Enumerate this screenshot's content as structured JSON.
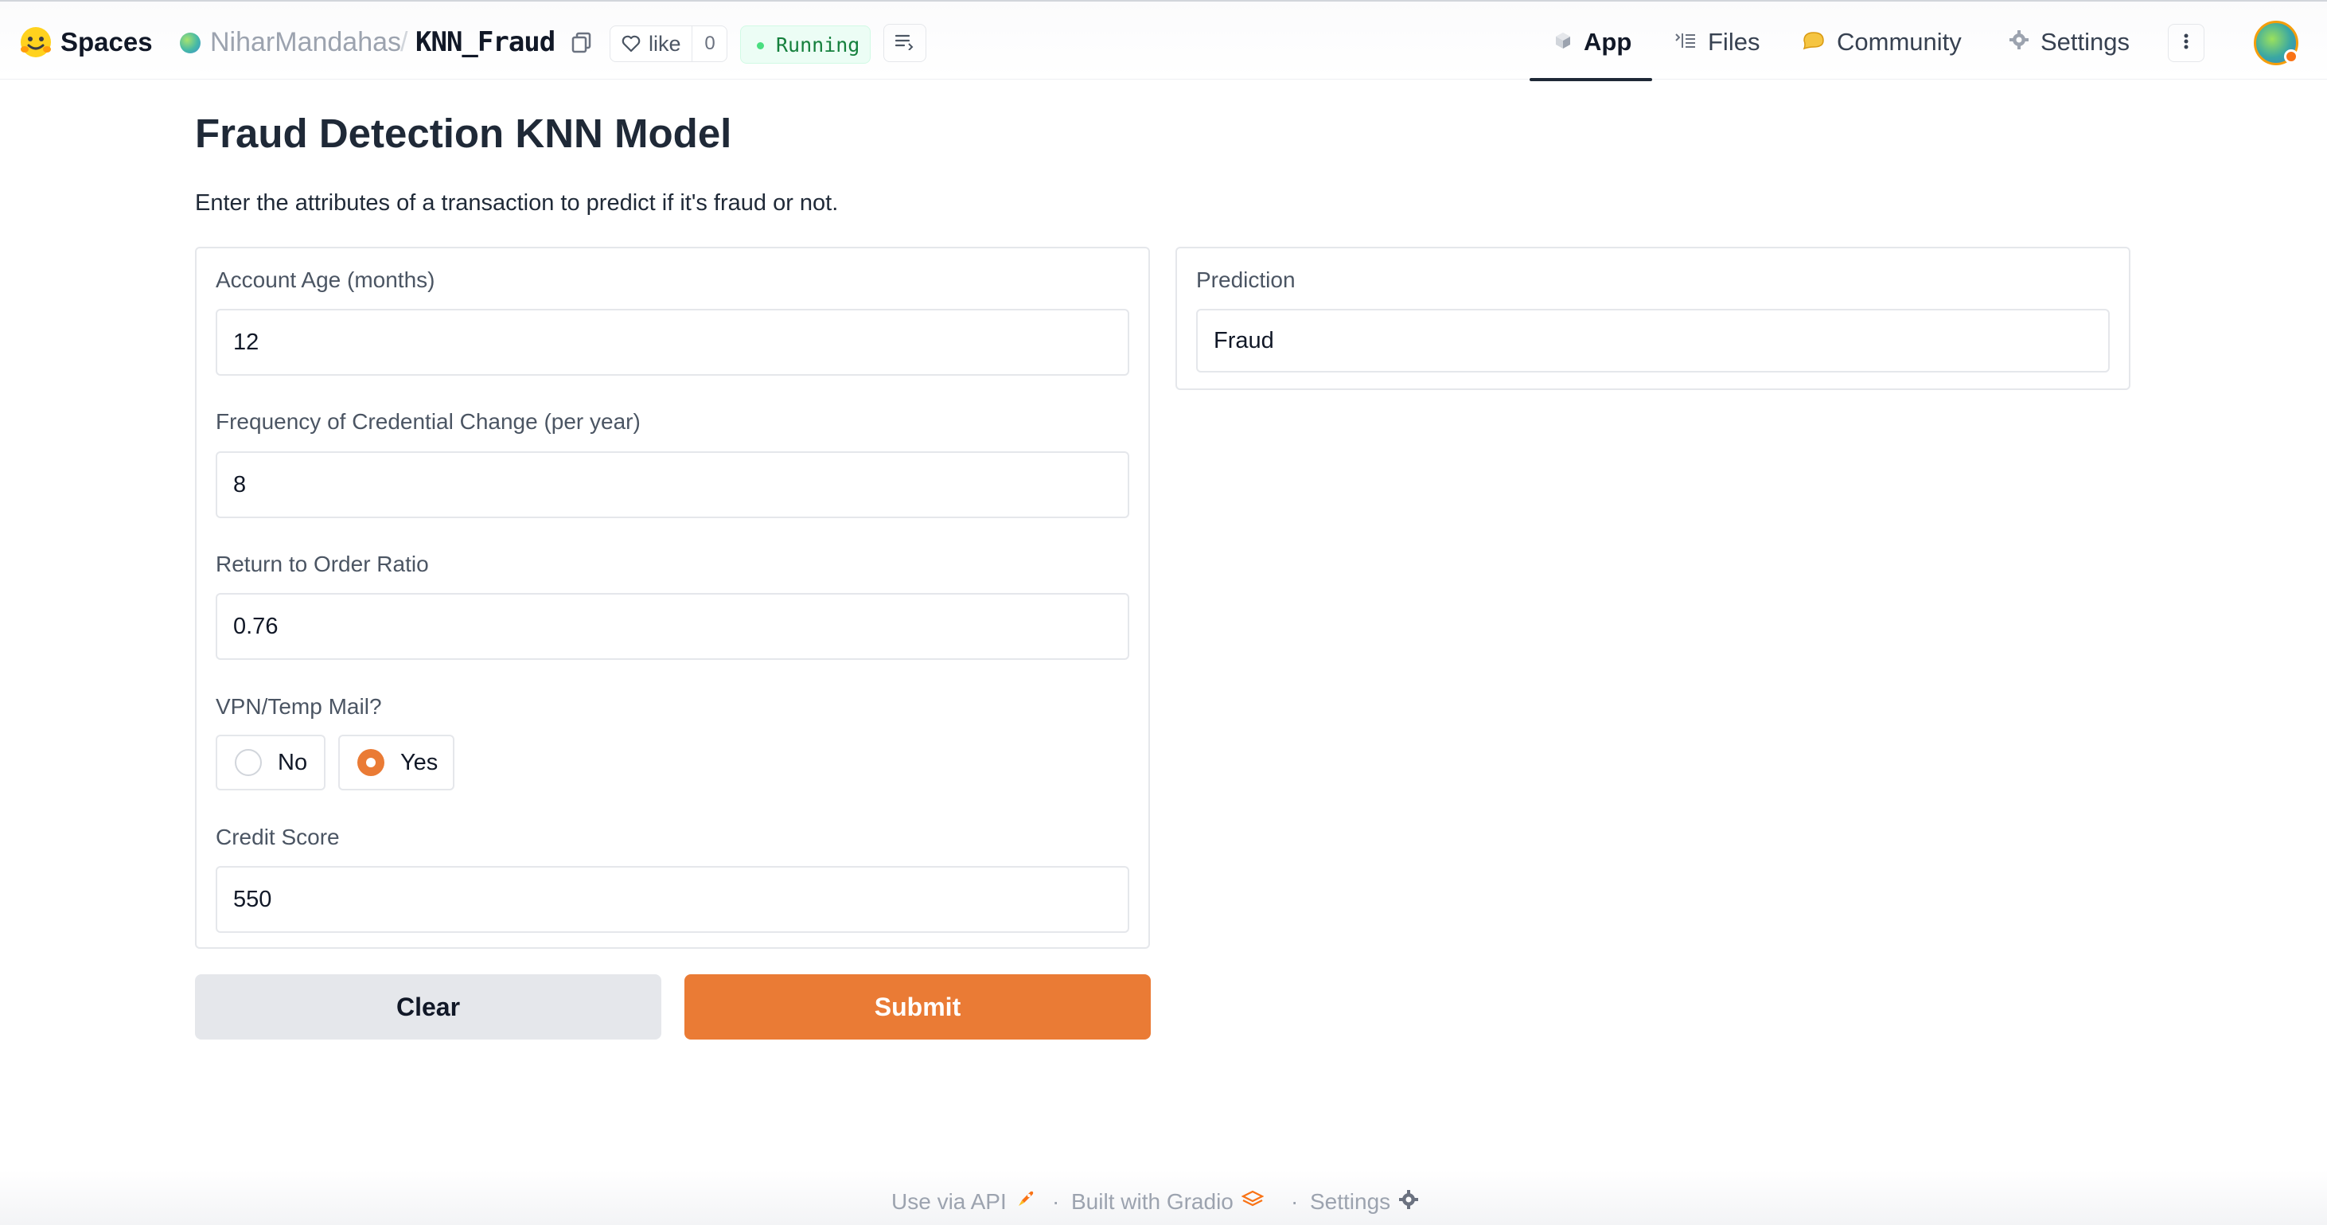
{
  "header": {
    "brand": "Spaces",
    "owner": "NiharMandahas",
    "separator": "/",
    "repo": "KNN_Fraud",
    "like_label": "like",
    "like_count": "0",
    "status": "Running",
    "nav": {
      "app": "App",
      "files": "Files",
      "community": "Community",
      "settings": "Settings"
    },
    "icons": [
      "hugging-face-logo-icon",
      "copy-icon",
      "heart-icon",
      "logs-icon",
      "cube-icon",
      "files-icon",
      "community-icon",
      "gear-icon",
      "more-vertical-icon"
    ]
  },
  "main": {
    "title": "Fraud Detection KNN Model",
    "description": "Enter the attributes of a transaction to predict if it's fraud or not.",
    "fields": {
      "account_age": {
        "label": "Account Age (months)",
        "value": "12"
      },
      "credential_change": {
        "label": "Frequency of Credential Change (per year)",
        "value": "8"
      },
      "return_ratio": {
        "label": "Return to Order Ratio",
        "value": "0.76"
      },
      "vpn": {
        "label": "VPN/Temp Mail?",
        "options": [
          "No",
          "Yes"
        ],
        "selected": "Yes"
      },
      "credit_score": {
        "label": "Credit Score",
        "value": "550"
      }
    },
    "output": {
      "label": "Prediction",
      "value": "Fraud"
    },
    "buttons": {
      "clear": "Clear",
      "submit": "Submit"
    }
  },
  "footer": {
    "api": "Use via API",
    "dot": "·",
    "built": "Built with Gradio",
    "settings": "Settings"
  },
  "colors": {
    "accent": "#ea7b35",
    "running_bg": "#ecfdf5",
    "running_text": "#15803d"
  }
}
